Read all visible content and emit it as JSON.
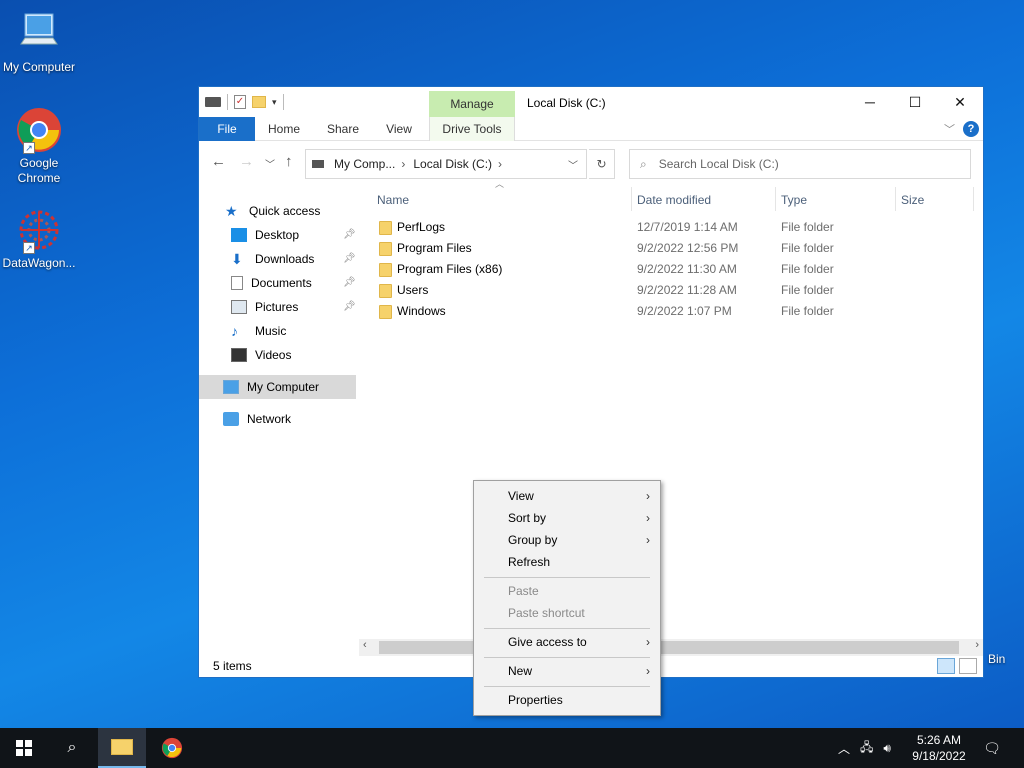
{
  "desktop": {
    "icons": [
      {
        "label": "My Computer",
        "icon": "computer-icon"
      },
      {
        "label": "Google Chrome",
        "icon": "chrome-icon"
      },
      {
        "label": "DataWagon...",
        "icon": "datawagon-icon"
      }
    ],
    "recycle_bin_label": "Bin"
  },
  "window": {
    "title": "Local Disk (C:)",
    "manage_label": "Manage",
    "ribbon_tabs": [
      "File",
      "Home",
      "Share",
      "View",
      "Drive Tools"
    ],
    "help_label": "?",
    "address": {
      "crumbs": [
        "My Comp...",
        "Local Disk (C:)"
      ]
    },
    "search_placeholder": "Search Local Disk (C:)",
    "nav": {
      "quick_access": "Quick access",
      "items": [
        "Desktop",
        "Downloads",
        "Documents",
        "Pictures",
        "Music",
        "Videos"
      ],
      "my_computer": "My Computer",
      "network": "Network"
    },
    "columns": [
      "Name",
      "Date modified",
      "Type",
      "Size"
    ],
    "files": [
      {
        "name": "PerfLogs",
        "date": "12/7/2019 1:14 AM",
        "type": "File folder"
      },
      {
        "name": "Program Files",
        "date": "9/2/2022 12:56 PM",
        "type": "File folder"
      },
      {
        "name": "Program Files (x86)",
        "date": "9/2/2022 11:30 AM",
        "type": "File folder"
      },
      {
        "name": "Users",
        "date": "9/2/2022 11:28 AM",
        "type": "File folder"
      },
      {
        "name": "Windows",
        "date": "9/2/2022 1:07 PM",
        "type": "File folder"
      }
    ],
    "status": "5 items"
  },
  "context_menu": {
    "items": [
      {
        "label": "View",
        "submenu": true,
        "disabled": false
      },
      {
        "label": "Sort by",
        "submenu": true,
        "disabled": false
      },
      {
        "label": "Group by",
        "submenu": true,
        "disabled": false
      },
      {
        "label": "Refresh",
        "submenu": false,
        "disabled": false
      },
      {
        "label": "Paste",
        "submenu": false,
        "disabled": true
      },
      {
        "label": "Paste shortcut",
        "submenu": false,
        "disabled": true
      },
      {
        "label": "Give access to",
        "submenu": true,
        "disabled": false
      },
      {
        "label": "New",
        "submenu": true,
        "disabled": false
      },
      {
        "label": "Properties",
        "submenu": false,
        "disabled": false
      }
    ]
  },
  "taskbar": {
    "time": "5:26 AM",
    "date": "9/18/2022"
  },
  "colors": {
    "accent": "#1a6fc9",
    "manage_tab": "#c8ecb0",
    "folder": "#f6d26b",
    "taskbar": "#101418"
  }
}
